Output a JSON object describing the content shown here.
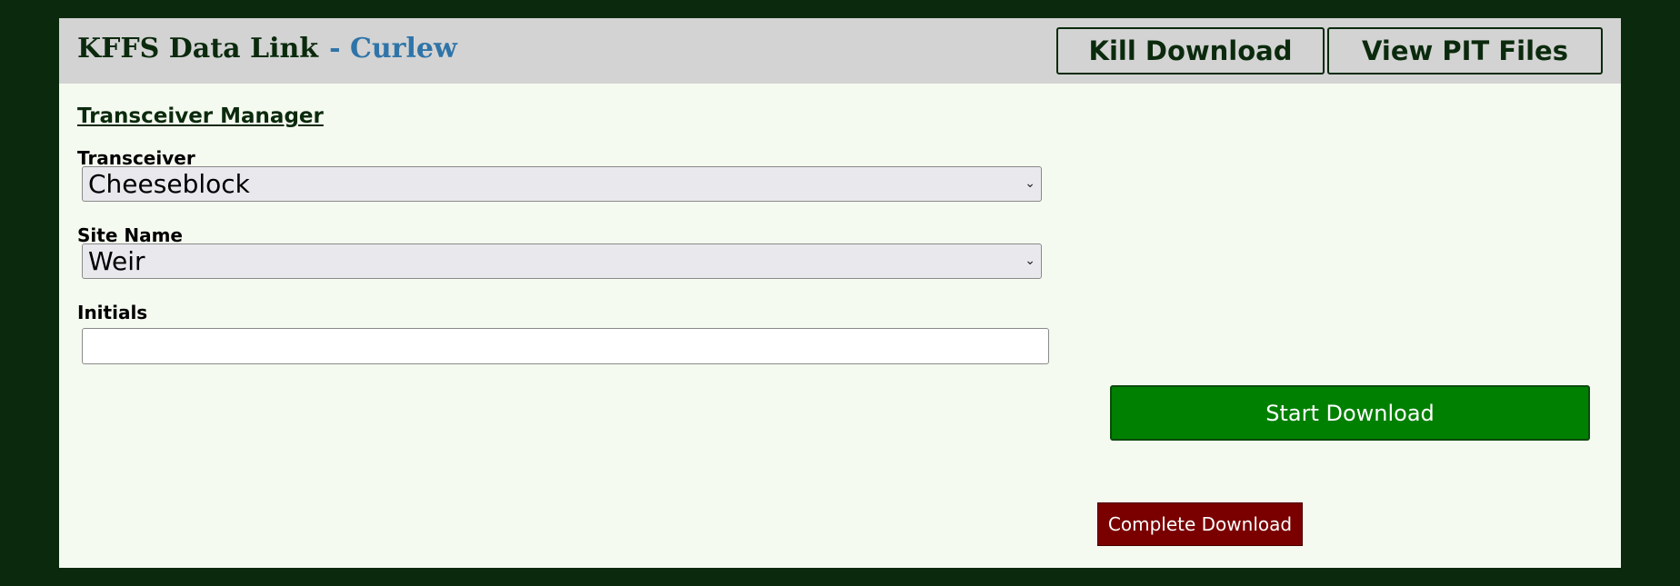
{
  "header": {
    "app_title": "KFFS Data Link",
    "site_suffix": "- Curlew",
    "kill_download_label": "Kill Download",
    "view_pit_files_label": "View PIT Files"
  },
  "main": {
    "section_title": "Transceiver Manager",
    "transceiver": {
      "label": "Transceiver",
      "selected": "Cheeseblock"
    },
    "site_name": {
      "label": "Site Name",
      "selected": "Weir"
    },
    "initials": {
      "label": "Initials",
      "value": "",
      "placeholder": ""
    },
    "start_download_label": "Start Download",
    "complete_download_label": "Complete Download"
  },
  "colors": {
    "page_background": "#0b2a0d",
    "panel_background": "#f5faf0",
    "header_background": "#d3d3d3",
    "site_accent": "#2f74a8",
    "start_button": "#008000",
    "complete_button": "#7a0000"
  },
  "icons": {
    "select_chevron": "chevron-down-icon"
  }
}
